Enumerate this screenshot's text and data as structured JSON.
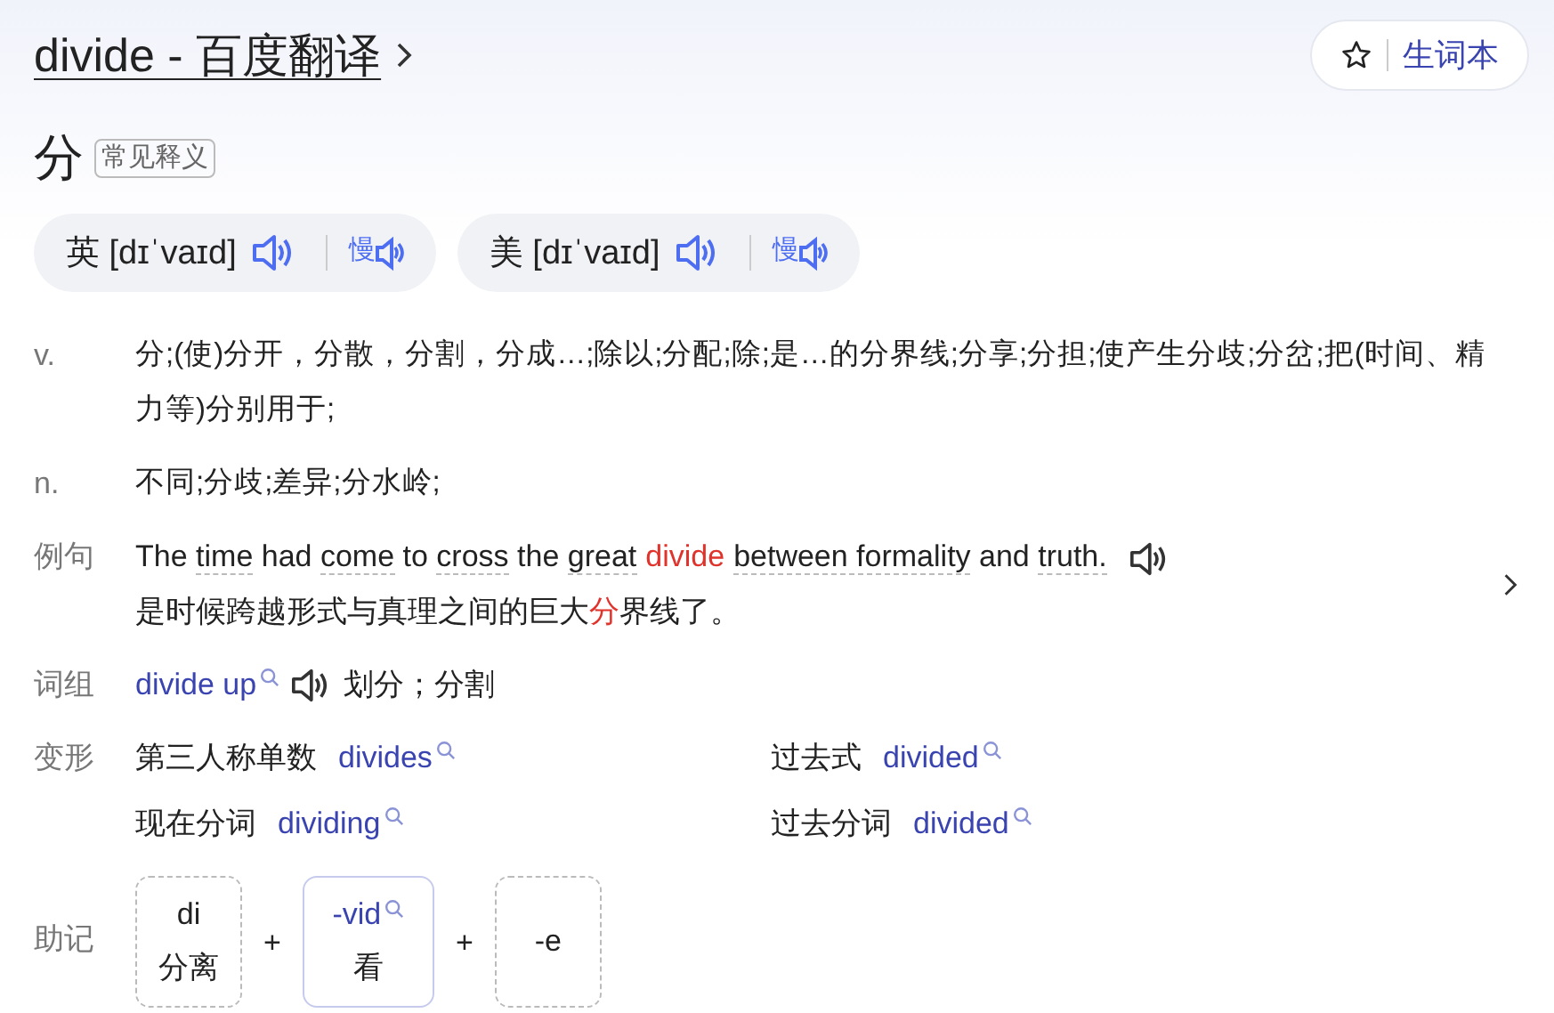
{
  "header": {
    "title": "divide - 百度翻译",
    "wordbook_button": "生词本"
  },
  "headword": {
    "translation": "分",
    "tag": "常见释义"
  },
  "pronunciations": [
    {
      "region": "英",
      "phonetic": "[dɪˈvaɪd]",
      "slow_label": "慢"
    },
    {
      "region": "美",
      "phonetic": "[dɪˈvaɪd]",
      "slow_label": "慢"
    }
  ],
  "definitions": [
    {
      "pos": "v.",
      "text": "分;(使)分开，分散，分割，分成…;除以;分配;除;是…的分界线;分享;分担;使产生分歧;分岔;把(时间、精力等)分别用于;"
    },
    {
      "pos": "n.",
      "text": "不同;分歧;差异;分水岭;"
    }
  ],
  "example": {
    "label": "例句",
    "tokens": [
      {
        "text": "The ",
        "kind": "plain"
      },
      {
        "text": "time",
        "kind": "link"
      },
      {
        "text": " had ",
        "kind": "plain"
      },
      {
        "text": "come",
        "kind": "link"
      },
      {
        "text": " to ",
        "kind": "plain"
      },
      {
        "text": "cross",
        "kind": "link"
      },
      {
        "text": " the ",
        "kind": "plain"
      },
      {
        "text": "great",
        "kind": "link"
      },
      {
        "text": "divide",
        "kind": "highlight"
      },
      {
        "text": "between formality",
        "kind": "link"
      },
      {
        "text": " and ",
        "kind": "plain"
      },
      {
        "text": "truth.",
        "kind": "link"
      }
    ],
    "translation_tokens": [
      {
        "text": "是时候跨越形式与真理之间的巨大",
        "kind": "plain"
      },
      {
        "text": "分",
        "kind": "highlight"
      },
      {
        "text": "界线了。",
        "kind": "plain"
      }
    ]
  },
  "phrases": {
    "label": "词组",
    "items": [
      {
        "phrase": "divide up",
        "meaning": "划分；分割"
      }
    ]
  },
  "forms": {
    "label": "变形",
    "items": [
      {
        "name": "第三人称单数",
        "word": "divides"
      },
      {
        "name": "过去式",
        "word": "divided"
      },
      {
        "name": "现在分词",
        "word": "dividing"
      },
      {
        "name": "过去分词",
        "word": "divided"
      }
    ]
  },
  "mnemonic": {
    "label": "助记",
    "parts": [
      {
        "kind": "plain",
        "root": "di",
        "meaning": "分离"
      },
      {
        "kind": "root",
        "root": "-vid",
        "meaning": "看"
      },
      {
        "kind": "plain",
        "root": "-e"
      }
    ],
    "joiner": "+"
  }
}
